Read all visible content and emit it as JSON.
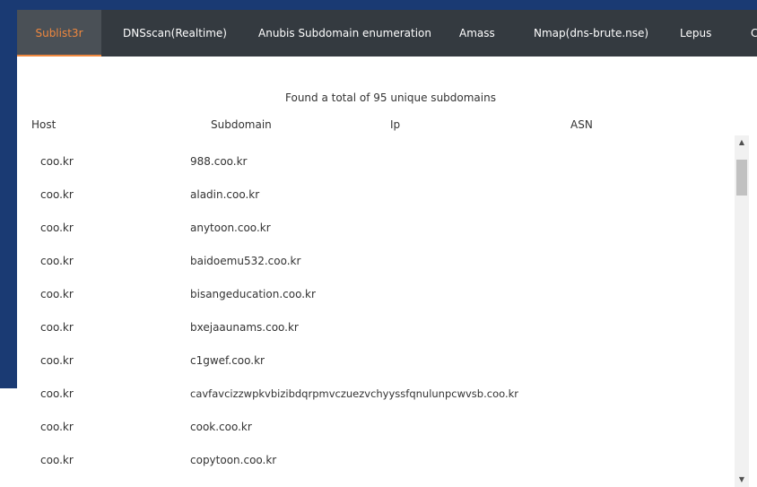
{
  "tabs": [
    {
      "label": "Sublist3r",
      "active": true
    },
    {
      "label": "DNSscan(Realtime)"
    },
    {
      "label": "Anubis Subdomain enumeration"
    },
    {
      "label": "Amass"
    },
    {
      "label": "Nmap(dns-brute.nse)"
    },
    {
      "label": "Lepus"
    },
    {
      "label": "C"
    }
  ],
  "summary": "Found a total of 95 unique subdomains",
  "table": {
    "headers": [
      "Host",
      "Subdomain",
      "Ip",
      "ASN"
    ],
    "rows": [
      {
        "host": "coo.kr",
        "subdomain": "988.coo.kr",
        "ip": "",
        "asn": ""
      },
      {
        "host": "coo.kr",
        "subdomain": "aladin.coo.kr",
        "ip": "",
        "asn": ""
      },
      {
        "host": "coo.kr",
        "subdomain": "anytoon.coo.kr",
        "ip": "",
        "asn": ""
      },
      {
        "host": "coo.kr",
        "subdomain": "baidoemu532.coo.kr",
        "ip": "",
        "asn": ""
      },
      {
        "host": "coo.kr",
        "subdomain": "bisangeducation.coo.kr",
        "ip": "",
        "asn": ""
      },
      {
        "host": "coo.kr",
        "subdomain": "bxejaaunams.coo.kr",
        "ip": "",
        "asn": ""
      },
      {
        "host": "coo.kr",
        "subdomain": "c1gwef.coo.kr",
        "ip": "",
        "asn": ""
      },
      {
        "host": "coo.kr",
        "subdomain": "cavfavcizzwpkvbizibdqrpmvczuezvchyyssfqnulunpcwvsb.coo.kr",
        "ip": "",
        "asn": ""
      },
      {
        "host": "coo.kr",
        "subdomain": "cook.coo.kr",
        "ip": "",
        "asn": ""
      },
      {
        "host": "coo.kr",
        "subdomain": "copytoon.coo.kr",
        "ip": "",
        "asn": ""
      }
    ]
  },
  "scrollbar": {
    "up_icon": "▲",
    "down_icon": "▼"
  }
}
